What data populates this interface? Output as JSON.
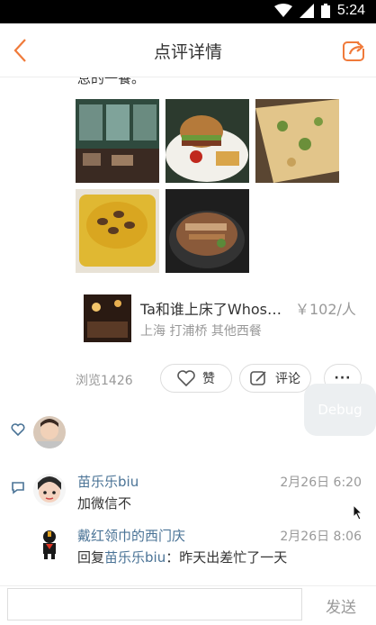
{
  "status_bar": {
    "time": "5:24"
  },
  "header": {
    "title": "点评详情"
  },
  "review": {
    "cut_text": "息的一餐。"
  },
  "venue": {
    "name": "Ta和谁上床了Whose...",
    "price": "￥102/人",
    "location": "上海 打浦桥 其他西餐"
  },
  "stats": {
    "views": "浏览1426",
    "like_label": "赞",
    "comment_label": "评论",
    "more_label": "···"
  },
  "debug_label": "Debug",
  "comments": [
    {
      "user": "苗乐乐biu",
      "time": "2月26日 6:20",
      "text": "加微信不"
    },
    {
      "user": "戴红领巾的西门庆",
      "time": "2月26日 8:06",
      "reply_prefix": "回复",
      "reply_to": "苗乐乐biu",
      "text": "：昨天出差忙了一天"
    }
  ],
  "input": {
    "placeholder": "",
    "send_label": "发送"
  },
  "colors": {
    "accent": "#f07a3a",
    "link": "#4a7396",
    "muted": "#999999"
  }
}
